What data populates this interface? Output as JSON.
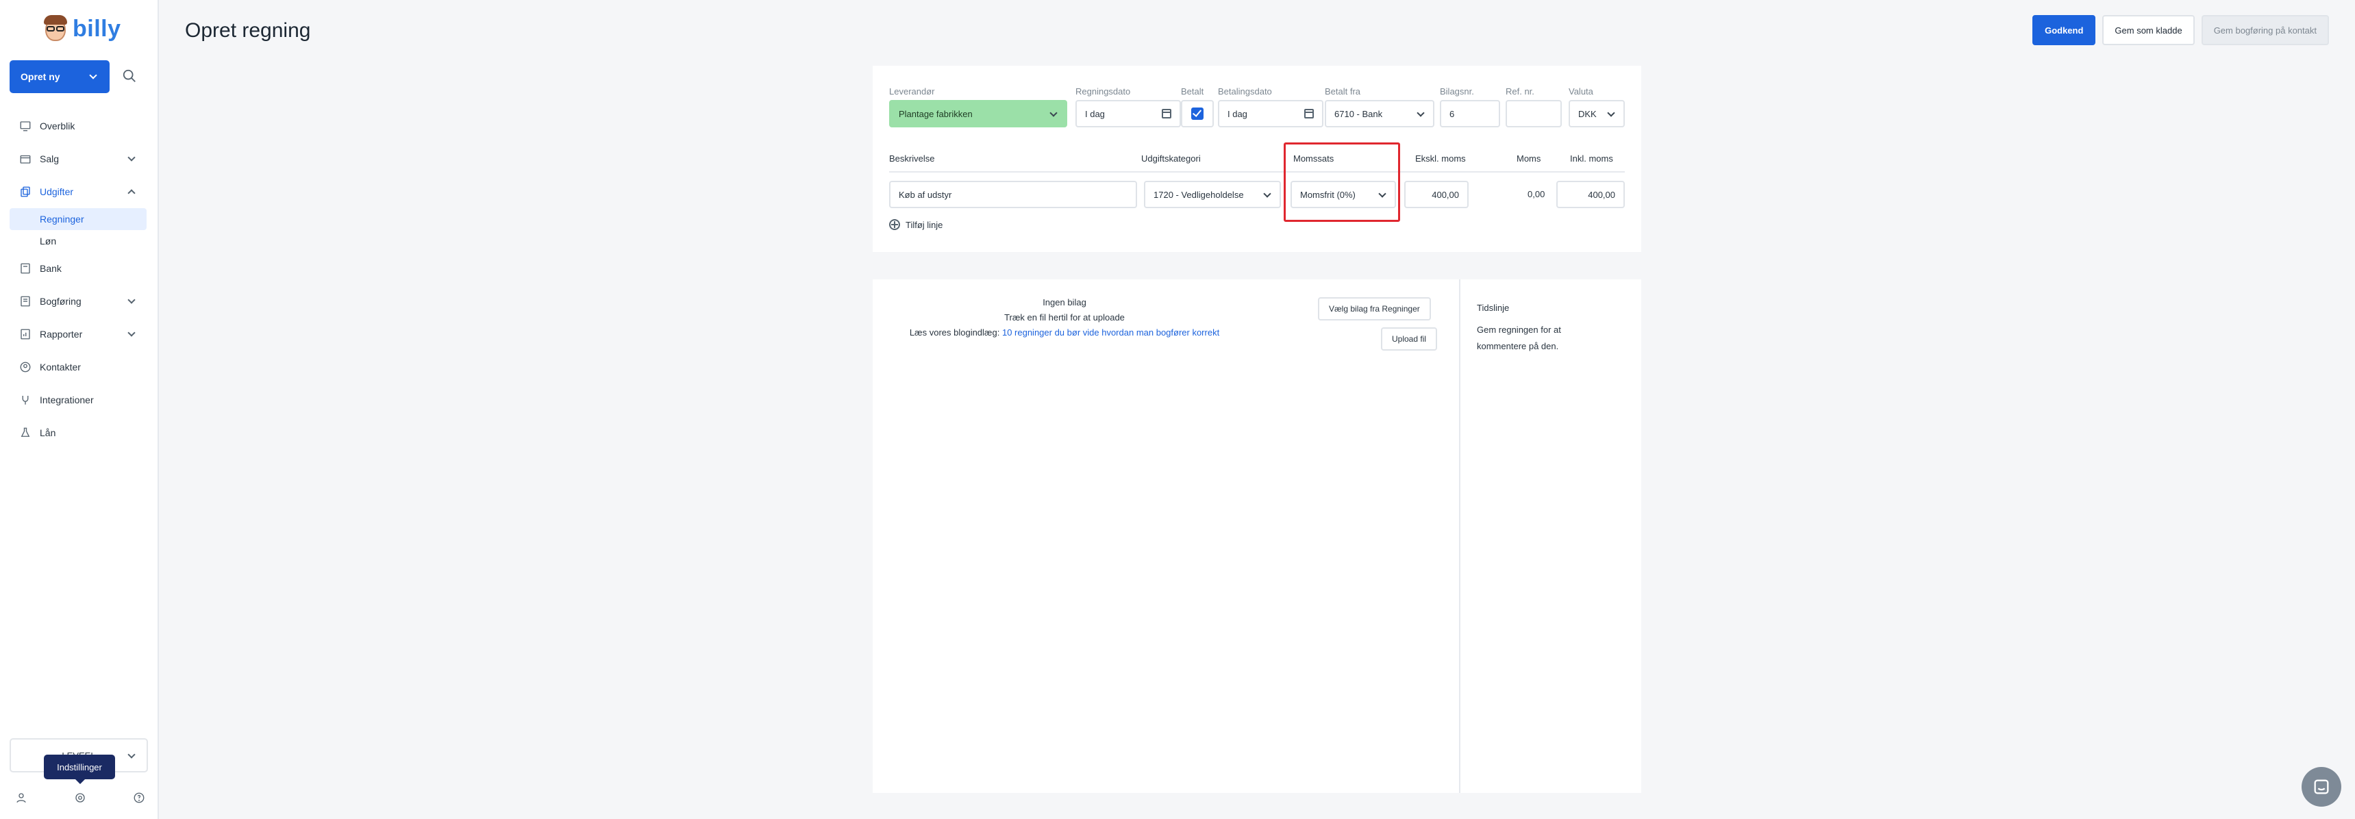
{
  "brand": {
    "name": "billy"
  },
  "sidebar": {
    "create_label": "Opret ny",
    "items": [
      {
        "label": "Overblik",
        "icon": "monitor-icon"
      },
      {
        "label": "Salg",
        "icon": "store-icon"
      },
      {
        "label": "Udgifter",
        "icon": "copy-icon"
      },
      {
        "label": "Bank",
        "icon": "bank-icon"
      },
      {
        "label": "Bogføring",
        "icon": "book-icon"
      },
      {
        "label": "Rapporter",
        "icon": "report-icon"
      },
      {
        "label": "Kontakter",
        "icon": "contact-icon"
      },
      {
        "label": "Integrationer",
        "icon": "plug-icon"
      },
      {
        "label": "Lån",
        "icon": "flask-icon"
      }
    ],
    "sub_items": [
      "Regninger",
      "Løn"
    ],
    "org_name": "LEVEEL",
    "tooltip": "Indstillinger"
  },
  "header": {
    "title": "Opret regning",
    "approve": "Godkend",
    "save_draft": "Gem som kladde",
    "save_contact": "Gem bogføring på kontakt"
  },
  "form": {
    "labels": {
      "supplier": "Leverandør",
      "bill_date": "Regningsdato",
      "paid": "Betalt",
      "payment_date": "Betalingsdato",
      "paid_from": "Betalt fra",
      "voucher_no": "Bilagsnr.",
      "ref_no": "Ref. nr.",
      "currency": "Valuta"
    },
    "values": {
      "supplier": "Plantage fabrikken",
      "bill_date": "I dag",
      "payment_date": "I dag",
      "paid_from": "6710 - Bank",
      "voucher_no": "6",
      "ref_no": "",
      "currency": "DKK"
    }
  },
  "lines": {
    "headers": {
      "description": "Beskrivelse",
      "category": "Udgiftskategori",
      "vat_rate": "Momssats",
      "excl_vat": "Ekskl. moms",
      "vat": "Moms",
      "incl_vat": "Inkl. moms"
    },
    "row": {
      "description": "Køb af udstyr",
      "category": "1720 - Vedligeholdelse",
      "vat_rate": "Momsfrit (0%)",
      "excl_vat": "400,00",
      "vat": "0,00",
      "incl_vat": "400,00"
    },
    "add_line": "Tilføj linje"
  },
  "attachments": {
    "no_attachment": "Ingen bilag",
    "drag_text": "Træk en fil hertil for at uploade",
    "read_prefix": "Læs vores blogindlæg:",
    "read_link": "10 regninger du bør vide hvordan man bogfører korrekt",
    "choose_btn": "Vælg bilag fra Regninger",
    "upload_btn": "Upload fil"
  },
  "timeline": {
    "title": "Tidslinje",
    "text": "Gem regningen for at kommentere på den."
  }
}
